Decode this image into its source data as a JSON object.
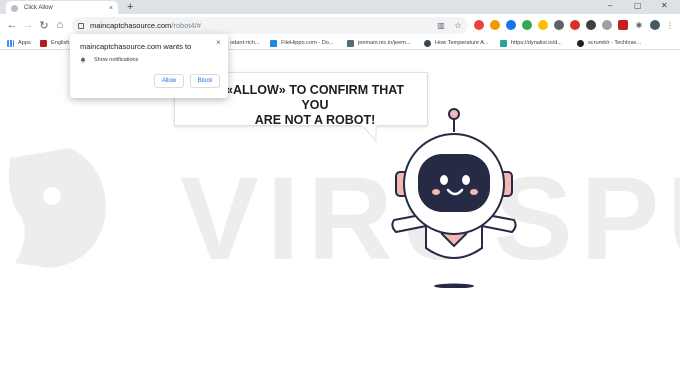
{
  "tab": {
    "title": "Click Allow",
    "close_glyph": "×",
    "new_tab_glyph": "+"
  },
  "window_controls": {
    "minimize": "–",
    "maximize": "▢",
    "close": "✕"
  },
  "address_bar": {
    "host": "maincaptchasource.com",
    "path": "/robot4/#"
  },
  "bookmarks": [
    {
      "label": "Apps"
    },
    {
      "label": "English"
    },
    {
      "label": "odant-rich..."
    },
    {
      "label": "FileHippo.com - Do..."
    },
    {
      "label": "jeemain.nic.in/jeem..."
    },
    {
      "label": "How Temperature A..."
    },
    {
      "label": "https://dynalist.io/d..."
    },
    {
      "label": "scrumblr - Techlose..."
    }
  ],
  "permission_popup": {
    "title": "maincaptchasource.com wants to",
    "permission": "Show notifications",
    "allow_label": "Allow",
    "block_label": "Block",
    "close_glyph": "×"
  },
  "page": {
    "bubble_line1": "«ALLOW» TO CONFIRM THAT YOU",
    "bubble_line2": "ARE NOT A ROBOT!",
    "watermark": "VIRUSPUP"
  },
  "colors": {
    "accent": "#1a73e8",
    "robot_pink": "#f4b8b4",
    "robot_navy": "#262a45",
    "watermark": "#ededed"
  }
}
